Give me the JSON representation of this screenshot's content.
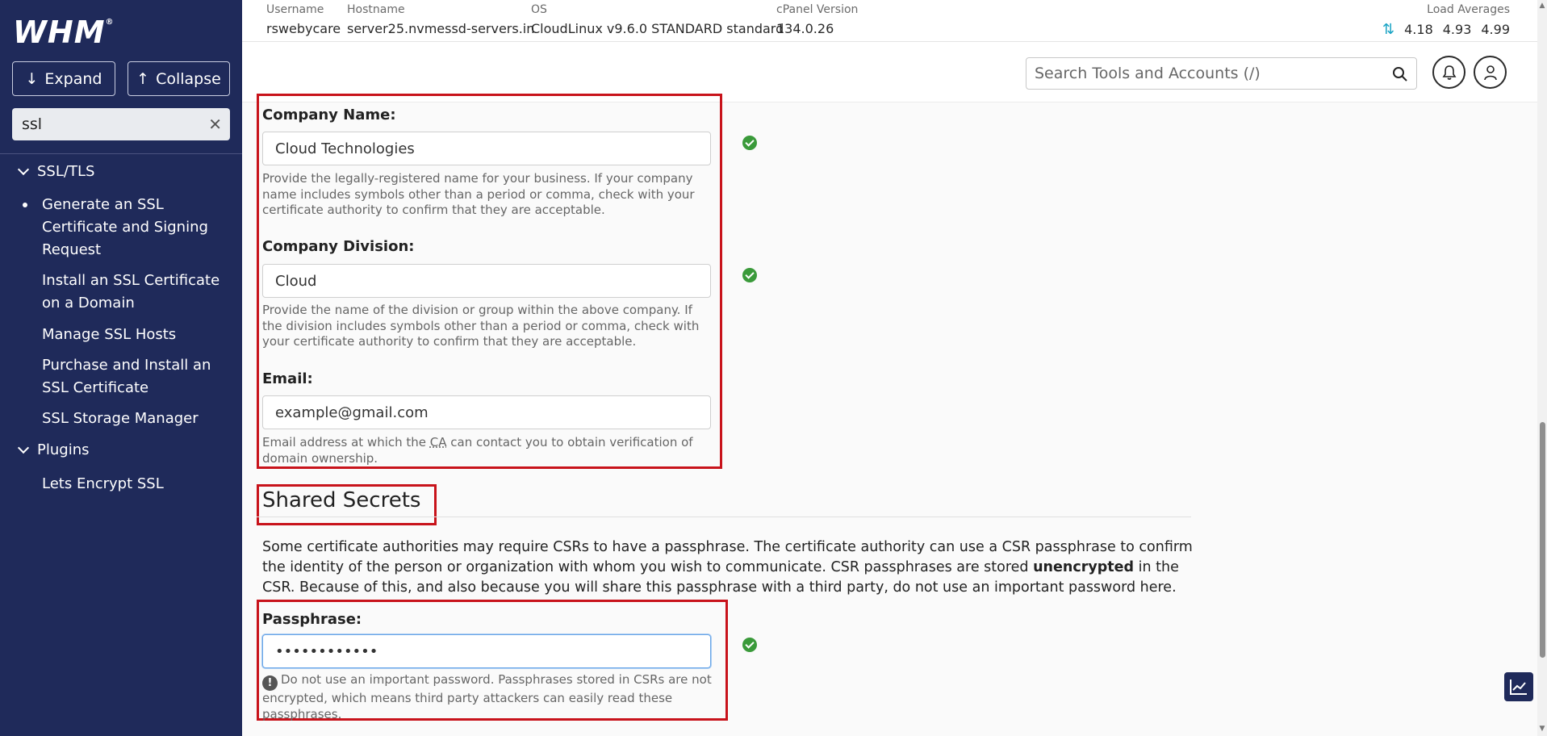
{
  "app": {
    "logo": "WHM",
    "logo_mark": "®"
  },
  "sidebar": {
    "expand_label": "Expand",
    "collapse_label": "Collapse",
    "search_value": "ssl",
    "groups": [
      {
        "label": "SSL/TLS"
      },
      {
        "label": "Plugins"
      }
    ],
    "items": [
      {
        "label": "Generate an SSL Certificate and Signing Request",
        "active": true
      },
      {
        "label": "Install an SSL Certificate on a Domain"
      },
      {
        "label": "Manage SSL Hosts"
      },
      {
        "label": "Purchase and Install an SSL Certificate"
      },
      {
        "label": "SSL Storage Manager"
      },
      {
        "label": "Lets Encrypt SSL"
      }
    ]
  },
  "server_info": {
    "username": {
      "label": "Username",
      "value": "rswebycare"
    },
    "hostname": {
      "label": "Hostname",
      "value": "server25.nvmessd-servers.in"
    },
    "os": {
      "label": "OS",
      "value": "CloudLinux v9.6.0 STANDARD standard"
    },
    "cpanel_version": {
      "label": "cPanel Version",
      "value": "134.0.26"
    },
    "load_averages": {
      "label": "Load Averages",
      "values": [
        "4.18",
        "4.93",
        "4.99"
      ]
    }
  },
  "search": {
    "placeholder": "Search Tools and Accounts (/)"
  },
  "form": {
    "company_name": {
      "label": "Company Name:",
      "value": "Cloud Technologies",
      "help": "Provide the legally-registered name for your business. If your company name includes symbols other than a period or comma, check with your certificate authority to confirm that they are acceptable."
    },
    "company_division": {
      "label": "Company Division:",
      "value": "Cloud",
      "help": "Provide the name of the division or group within the above company. If the division includes symbols other than a period or comma, check with your certificate authority to confirm that they are acceptable."
    },
    "email": {
      "label": "Email:",
      "value": "example@gmail.com",
      "help_before": "Email address at which the ",
      "help_abbr": "CA",
      "help_after": " can contact you to obtain verification of domain ownership."
    },
    "shared_secrets": {
      "title": "Shared Secrets",
      "para_before": "Some certificate authorities may require CSRs to have a passphrase. The certificate authority can use a CSR passphrase to confirm the identity of the person or organization with whom you wish to communicate. CSR passphrases are stored ",
      "para_bold": "unencrypted",
      "para_after": " in the CSR. Because of this, and also because you will share this passphrase with a third party, do not use an important password here."
    },
    "passphrase": {
      "label": "Passphrase:",
      "value": "••••••••••••",
      "warning": "Do not use an important password. Passphrases stored in CSRs are not encrypted, which means third party attackers can easily read these passphrases."
    }
  },
  "colors": {
    "sidebar_bg": "#1f2a5a",
    "highlight_border": "#c8131b",
    "valid_check": "#3a9a3a",
    "load_arrows": "#18a3c4"
  }
}
